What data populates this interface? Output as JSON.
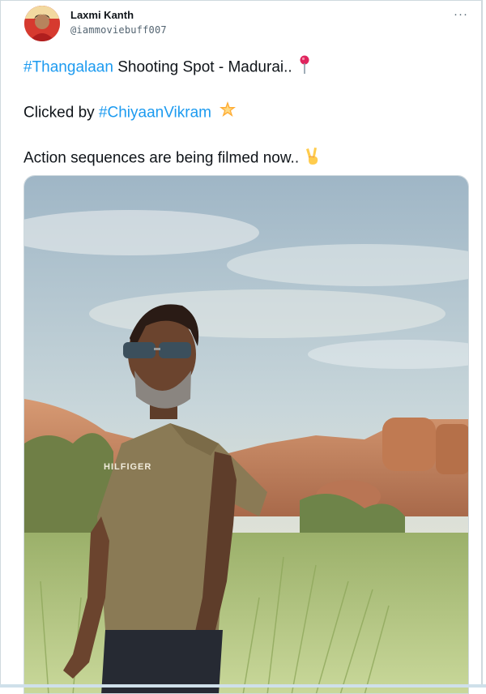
{
  "tweet": {
    "author_name": "Laxmi Kanth",
    "author_handle": "@iammoviebuff007",
    "more_label": "···",
    "line1": {
      "hashtag": "#Thangalaan",
      "text": " Shooting Spot - Madurai..",
      "emoji": "round-pushpin-icon"
    },
    "line2": {
      "prefix": "Clicked by ",
      "hashtag": "#ChiyaanVikram",
      "emoji": "glowing-star-icon"
    },
    "line3": {
      "text": "Action sequences are being filmed now..",
      "emoji": "victory-hand-icon"
    },
    "image": {
      "shirt_text": "HILFIGER"
    }
  },
  "colors": {
    "link": "#1d9bf0",
    "text": "#0f1419",
    "muted": "#536471"
  }
}
